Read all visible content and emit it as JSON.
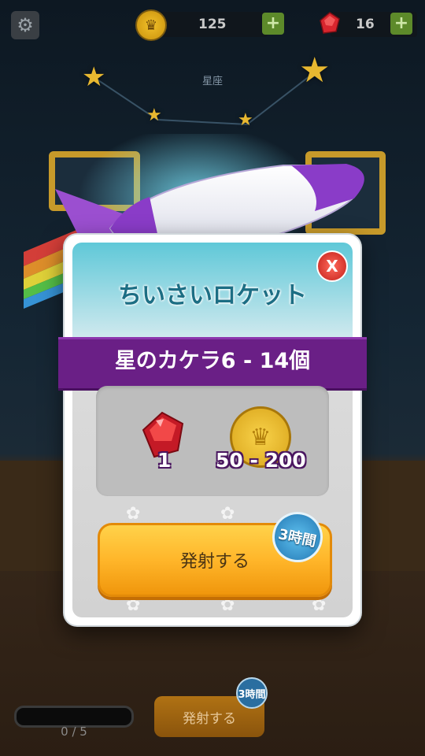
{
  "header": {
    "coins": "125",
    "gems": "16",
    "plus_label": "+",
    "settings_icon": "gear-icon",
    "coin_icon": "crown-coin-icon",
    "gem_icon": "red-gem-icon"
  },
  "background": {
    "constellation_title": "星座",
    "progress_text": "0 / 5",
    "progress_fraction": 0,
    "launch_label": "発射する",
    "timer_label": "3時間"
  },
  "dialog": {
    "title": "ちいさいロケット",
    "banner": "星のカケラ6 - 14個",
    "close_label": "X",
    "rewards": [
      {
        "icon": "red-gem-icon",
        "amount": "1"
      },
      {
        "icon": "crown-coin-icon",
        "amount": "50 - 200"
      }
    ],
    "launch_button": "発射する",
    "time_badge": "3時間"
  },
  "colors": {
    "banner": "#6a1f86",
    "launch_button": "#ffb62a",
    "title_text": "#1c6e84",
    "close_button": "#c3201a"
  }
}
